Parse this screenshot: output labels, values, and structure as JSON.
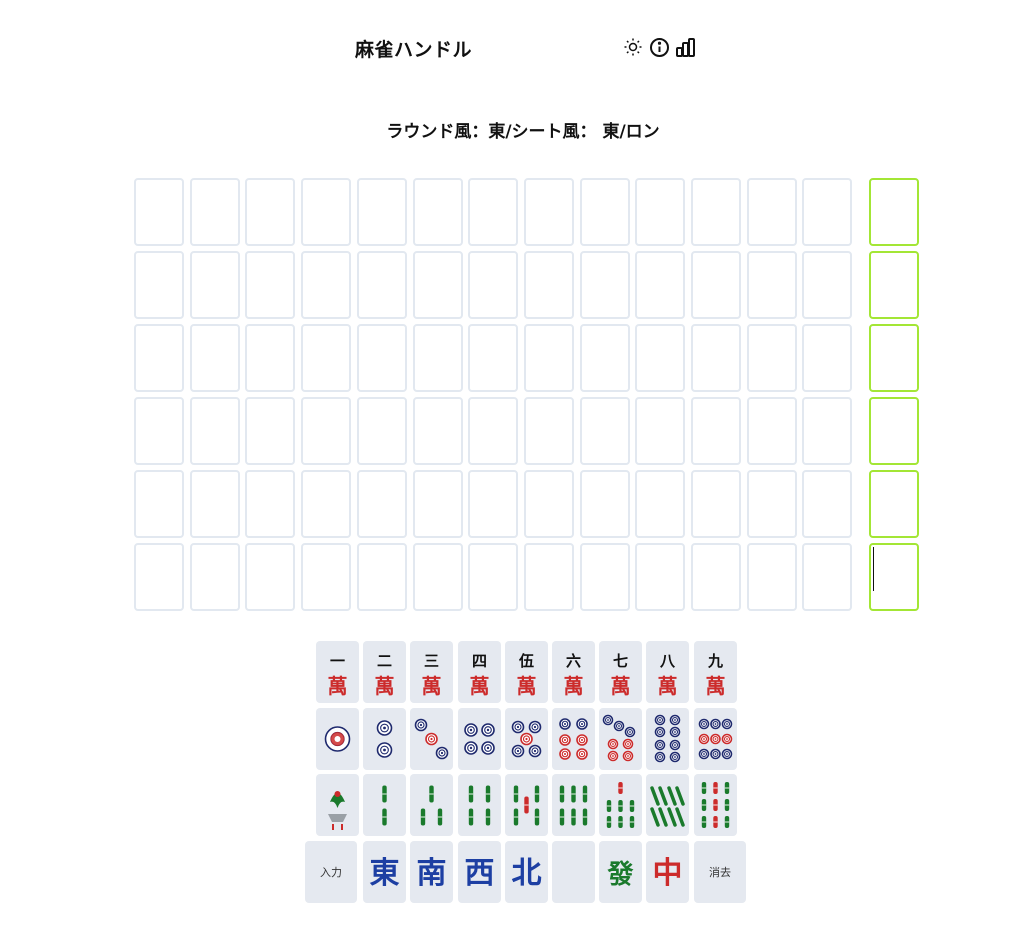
{
  "header": {
    "title": "麻雀ハンドル",
    "icons": [
      "sun-icon",
      "info-icon",
      "stats-icon"
    ]
  },
  "round_info": "ラウンド風：東/シート風： 東/ロン",
  "board": {
    "rows": 6,
    "columns": 14,
    "win_column_color": "#a3e635",
    "cell_border_color": "#e2e8f0"
  },
  "keyboard": {
    "man_numerals": [
      "一",
      "二",
      "三",
      "四",
      "伍",
      "六",
      "七",
      "八",
      "九"
    ],
    "man_suit_char": "萬",
    "pin_counts": [
      1,
      2,
      3,
      4,
      5,
      6,
      7,
      8,
      9
    ],
    "sou_counts": [
      1,
      2,
      3,
      4,
      5,
      6,
      7,
      8,
      9
    ],
    "enter_label": "入力",
    "delete_label": "消去",
    "honor_chars": [
      "東",
      "南",
      "西",
      "北",
      "",
      "發",
      "中"
    ],
    "colors": {
      "key_bg": "#e5e9f0",
      "red": "#cc2b2b",
      "navy": "#1f2a6e",
      "green": "#1a7a2c",
      "honor_blue": "#1d3fa3"
    }
  }
}
